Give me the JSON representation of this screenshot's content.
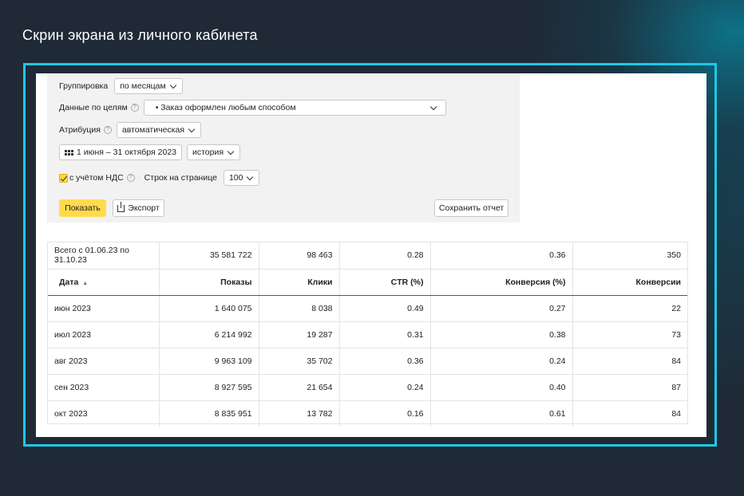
{
  "page": {
    "heading": "Скрин экрана из личного кабинета"
  },
  "filters": {
    "grouping": {
      "label": "Группировка",
      "value": "по месяцам"
    },
    "goals": {
      "label": "Данные по целям",
      "value": "• Заказ оформлен любым способом"
    },
    "attribution": {
      "label": "Атрибуция",
      "value": "автоматическая"
    },
    "date_range": {
      "value": "1 июня – 31 октября 2023"
    },
    "history": {
      "value": "история"
    },
    "vat": {
      "label": "с учётом НДС",
      "checked": true
    },
    "rows_per_page": {
      "label": "Строк на странице",
      "value": "100"
    }
  },
  "buttons": {
    "show": "Показать",
    "export": "Экспорт",
    "save": "Сохранить отчет"
  },
  "colors": {
    "accent_yellow": "#ffdb4d",
    "frame": "#1ec8e6"
  },
  "table": {
    "totals": [
      "Всего с 01.06.23 по 31.10.23",
      "35 581 722",
      "98 463",
      "0.28",
      "0.36",
      "350"
    ],
    "columns": [
      "Дата",
      "Показы",
      "Клики",
      "CTR (%)",
      "Конверсия (%)",
      "Конверсии"
    ],
    "sort_indicator": "▲",
    "rows": [
      [
        "июн 2023",
        "1 640 075",
        "8 038",
        "0.49",
        "0.27",
        "22"
      ],
      [
        "июл 2023",
        "6 214 992",
        "19 287",
        "0.31",
        "0.38",
        "73"
      ],
      [
        "авг 2023",
        "9 963 109",
        "35 702",
        "0.36",
        "0.24",
        "84"
      ],
      [
        "сен 2023",
        "8 927 595",
        "21 654",
        "0.24",
        "0.40",
        "87"
      ],
      [
        "окт 2023",
        "8 835 951",
        "13 782",
        "0.16",
        "0.61",
        "84"
      ]
    ]
  }
}
